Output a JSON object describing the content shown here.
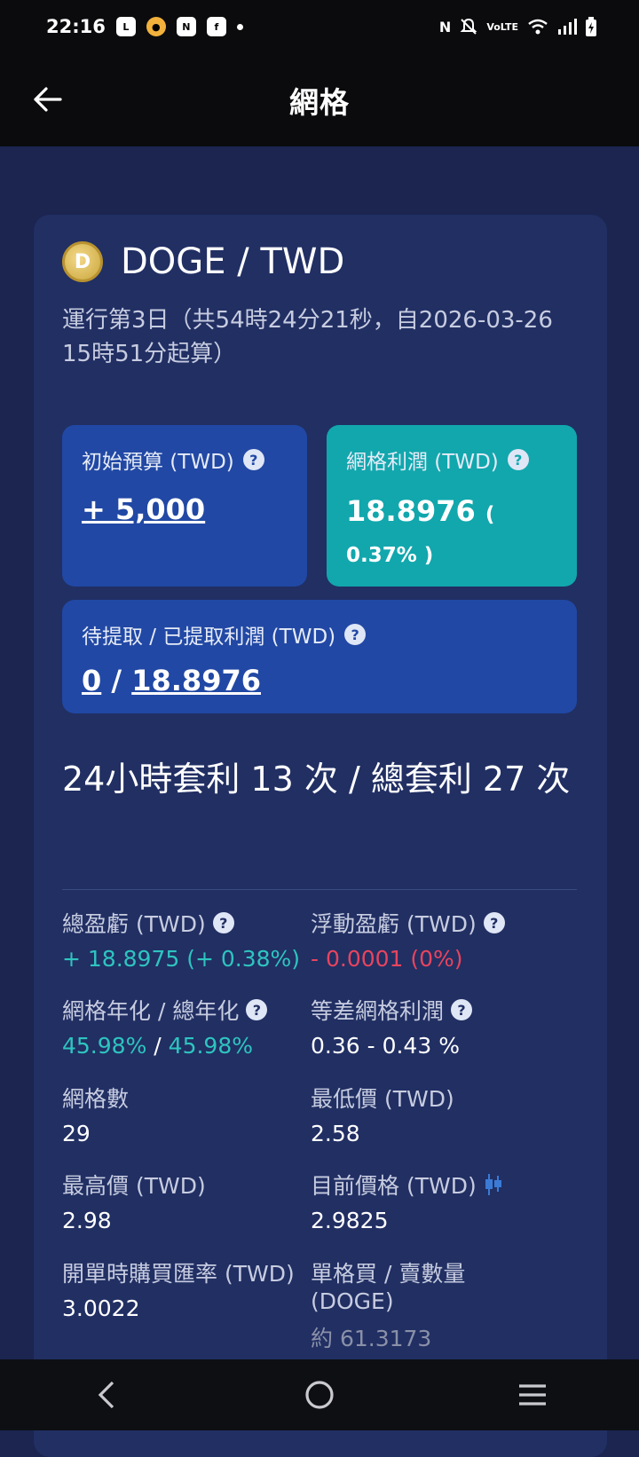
{
  "status_bar": {
    "time": "22:16",
    "network": "VoLTE"
  },
  "header": {
    "title": "網格"
  },
  "pair": {
    "logo_letter": "D",
    "name": "DOGE / TWD",
    "run_info": "運行第3日（共54時24分21秒，自2026-03-26 15時51分起算）"
  },
  "budget": {
    "label": "初始預算 (TWD)",
    "value": "+ 5,000"
  },
  "grid_profit": {
    "label": "網格利潤 (TWD)",
    "value": "18.8976",
    "pct": "( 0.37% )"
  },
  "pending": {
    "label": "待提取 / 已提取利潤 (TWD)",
    "pending_value": "0",
    "sep": "/",
    "withdrawn_value": "18.8976"
  },
  "arbitrage": {
    "text": "24小時套利 13 次 / 總套利 27 次"
  },
  "info": {
    "total_pnl": {
      "label": "總盈虧 (TWD)",
      "value": "+ 18.8975 (+ 0.38%)"
    },
    "floating_pnl": {
      "label": "浮動盈虧 (TWD)",
      "value": "- 0.0001 (0%)"
    },
    "annualized": {
      "label": "網格年化 / 總年化",
      "value_a": "45.98%",
      "sep": "/",
      "value_b": "45.98%"
    },
    "diff_profit": {
      "label": "等差網格利潤",
      "value": "0.36 - 0.43 %"
    },
    "grid_count": {
      "label": "網格數",
      "value": "29"
    },
    "min_price": {
      "label": "最低價 (TWD)",
      "value": "2.58"
    },
    "max_price": {
      "label": "最高價 (TWD)",
      "value": "2.98"
    },
    "current_price": {
      "label": "目前價格 (TWD)",
      "value": "2.9825"
    },
    "open_rate": {
      "label": "開單時購買匯率 (TWD)",
      "value": "3.0022"
    },
    "per_grid": {
      "label": "單格買 / 賣數量 (DOGE)",
      "value": "約 61.3173"
    }
  },
  "colors": {
    "background": "#1b2550",
    "card": "#212f63",
    "blue_box": "#2148a4",
    "teal_box": "#11a7ad",
    "green": "#2ec4bf",
    "red": "#e8445e"
  }
}
